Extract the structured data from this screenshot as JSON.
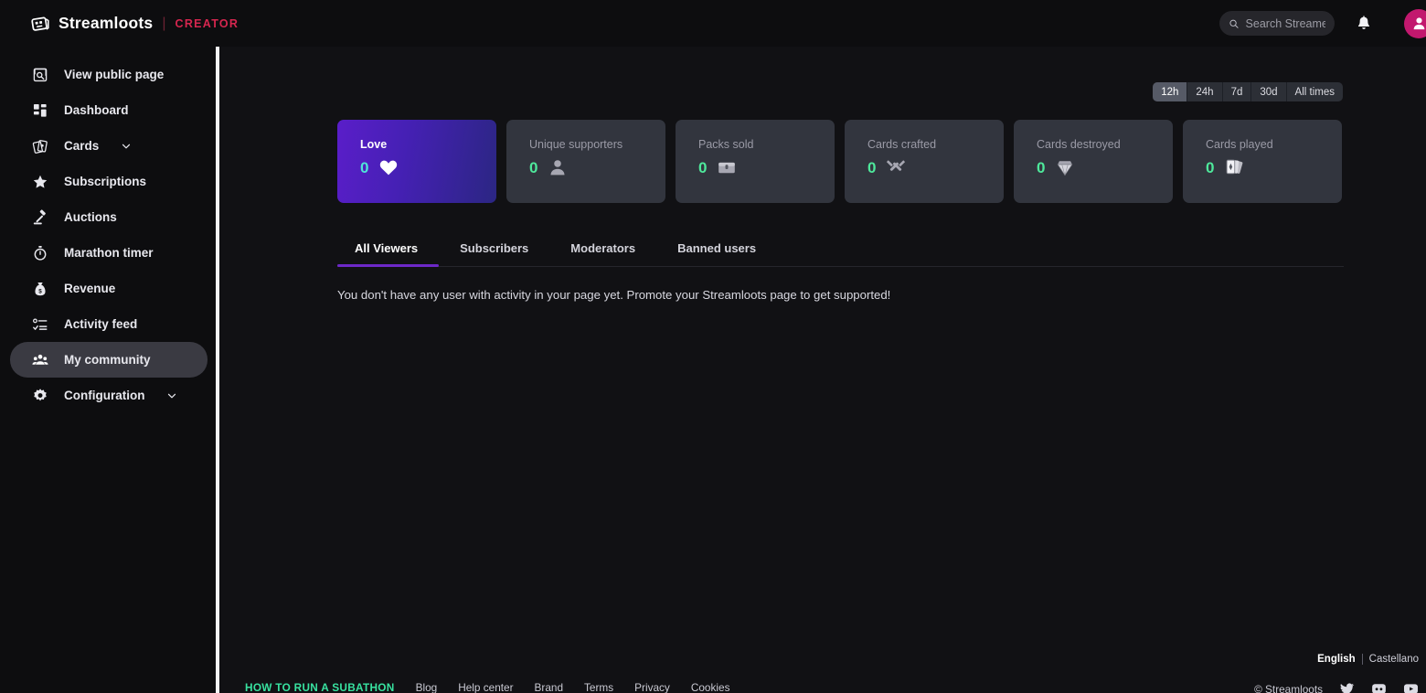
{
  "header": {
    "brand_name": "Streamloots",
    "brand_separator": "|",
    "brand_badge": "CREATOR",
    "search_placeholder": "Search Streamer",
    "search_value": "",
    "icons": {
      "search": "search-icon",
      "bell": "bell-icon",
      "avatar": "user-avatar"
    },
    "accent_red": "#d6264f",
    "avatar_color": "#c2186e"
  },
  "sidebar": {
    "items": [
      {
        "label": "View public page",
        "icon": "external-page-icon",
        "active": false,
        "expandable": false
      },
      {
        "label": "Dashboard",
        "icon": "grid-dashboard-icon",
        "active": false,
        "expandable": false
      },
      {
        "label": "Cards",
        "icon": "cards-icon",
        "active": false,
        "expandable": true
      },
      {
        "label": "Subscriptions",
        "icon": "star-icon",
        "active": false,
        "expandable": false
      },
      {
        "label": "Auctions",
        "icon": "gavel-icon",
        "active": false,
        "expandable": false
      },
      {
        "label": "Marathon timer",
        "icon": "stopwatch-icon",
        "active": false,
        "expandable": false
      },
      {
        "label": "Revenue",
        "icon": "money-bag-icon",
        "active": false,
        "expandable": false
      },
      {
        "label": "Activity feed",
        "icon": "checklist-icon",
        "active": false,
        "expandable": false
      },
      {
        "label": "My community",
        "icon": "people-icon",
        "active": true,
        "expandable": false
      },
      {
        "label": "Configuration",
        "icon": "gear-icon",
        "active": false,
        "expandable": true
      }
    ],
    "active_bg": "#3a3a42"
  },
  "main": {
    "time_ranges": [
      {
        "label": "12h",
        "active": true
      },
      {
        "label": "24h",
        "active": false
      },
      {
        "label": "7d",
        "active": false
      },
      {
        "label": "30d",
        "active": false
      },
      {
        "label": "All times",
        "active": false
      }
    ],
    "stats": [
      {
        "title": "Love",
        "value": "0",
        "icon": "heart-icon",
        "highlight": true
      },
      {
        "title": "Unique supporters",
        "value": "0",
        "icon": "person-icon",
        "highlight": false
      },
      {
        "title": "Packs sold",
        "value": "0",
        "icon": "chest-icon",
        "highlight": false
      },
      {
        "title": "Cards crafted",
        "value": "0",
        "icon": "tools-icon",
        "highlight": false
      },
      {
        "title": "Cards destroyed",
        "value": "0",
        "icon": "gem-icon",
        "highlight": false
      },
      {
        "title": "Cards played",
        "value": "0",
        "icon": "playing-cards-icon",
        "highlight": false
      }
    ],
    "tabs": [
      {
        "label": "All Viewers",
        "active": true
      },
      {
        "label": "Subscribers",
        "active": false
      },
      {
        "label": "Moderators",
        "active": false
      },
      {
        "label": "Banned users",
        "active": false
      }
    ],
    "empty_message": "You don't have any user with activity in your page yet. Promote your Streamloots page to get supported!",
    "tab_accent": "#6d28c8",
    "stat_value_color": "#4ee89b"
  },
  "footer": {
    "cta": "HOW TO RUN A SUBATHON",
    "links": [
      "Blog",
      "Help center",
      "Brand",
      "Terms",
      "Privacy",
      "Cookies"
    ],
    "languages": [
      {
        "label": "English",
        "active": true
      },
      {
        "label": "Castellano",
        "active": false
      }
    ],
    "copyright": "© Streamloots",
    "socials": [
      "twitter-icon",
      "discord-icon",
      "youtube-icon"
    ],
    "cta_color": "#38e2a0"
  }
}
